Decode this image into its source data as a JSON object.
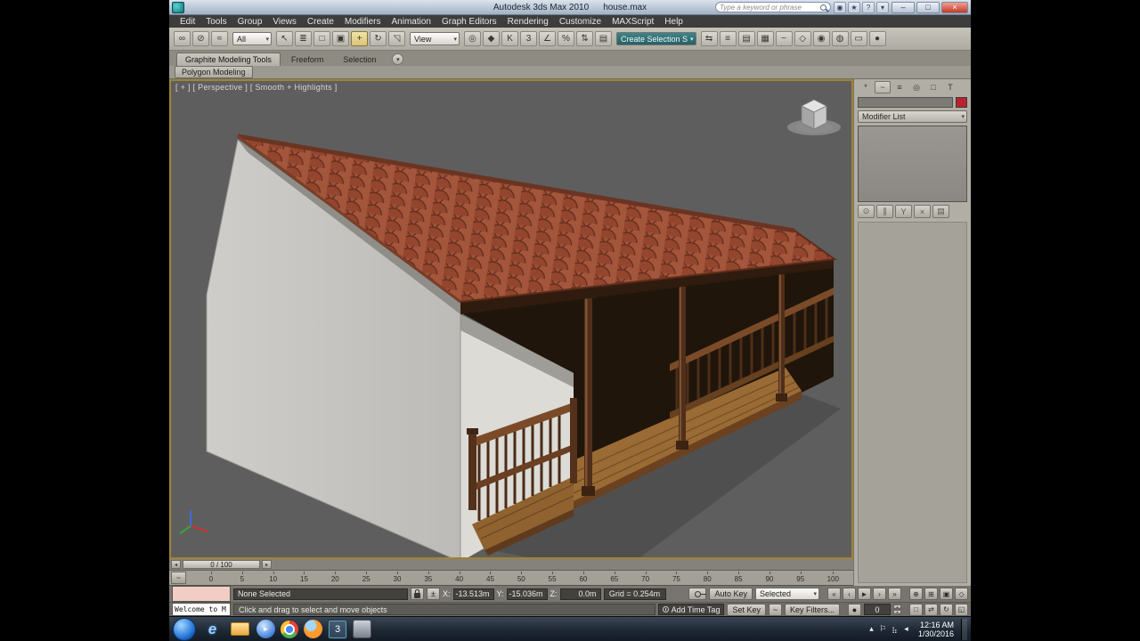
{
  "colors": {
    "brand_teal": "#1f9ca3",
    "object_color_swatch": "#b8232e",
    "viewport_border": "#a08433",
    "close_button_red": "#c23b28",
    "active_tool_highlight": "#e8d28a"
  },
  "titlebar": {
    "app_title": "Autodesk 3ds Max 2010",
    "file_name": "house.max",
    "search_placeholder": "Type a keyword or phrase",
    "infocenter_icons": [
      {
        "name": "communication-center-icon",
        "glyph": "◉"
      },
      {
        "name": "favorites-star-icon",
        "glyph": "★"
      },
      {
        "name": "help-icon",
        "glyph": "?"
      },
      {
        "name": "infocenter-menu-icon",
        "glyph": "▾"
      }
    ],
    "window_buttons": [
      {
        "name": "minimize-button",
        "glyph": "–"
      },
      {
        "name": "maximize-button",
        "glyph": "□"
      },
      {
        "name": "close-button",
        "glyph": "×",
        "cls": "close"
      }
    ]
  },
  "menubar": {
    "items": [
      "Edit",
      "Tools",
      "Group",
      "Views",
      "Create",
      "Modifiers",
      "Animation",
      "Graph Editors",
      "Rendering",
      "Customize",
      "MAXScript",
      "Help"
    ]
  },
  "toolbar": {
    "selection_filter_value": "All",
    "coordinate_system_value": "View",
    "named_sets_value": "Create Selection S",
    "segment1": [
      {
        "name": "select-and-link-icon",
        "glyph": "∞"
      },
      {
        "name": "unlink-selection-icon",
        "glyph": "⊘"
      },
      {
        "name": "bind-to-space-warp-icon",
        "glyph": "≈"
      }
    ],
    "segment2": [
      {
        "name": "select-object-icon",
        "glyph": "↖"
      },
      {
        "name": "select-by-name-icon",
        "glyph": "≣"
      },
      {
        "name": "rectangular-selection-region-icon",
        "glyph": "□"
      },
      {
        "name": "window-crossing-toggle-icon",
        "glyph": "▣"
      },
      {
        "name": "select-and-move-icon",
        "glyph": "+",
        "active": true
      },
      {
        "name": "select-and-rotate-icon",
        "glyph": "↻"
      },
      {
        "name": "select-and-scale-icon",
        "glyph": "◹"
      }
    ],
    "segment3": [
      {
        "name": "use-pivot-center-icon",
        "glyph": "◎"
      },
      {
        "name": "select-and-manipulate-icon",
        "glyph": "◆"
      },
      {
        "name": "keyboard-shortcut-override-icon",
        "glyph": "K"
      },
      {
        "name": "snaps-toggle-icon",
        "glyph": "3"
      },
      {
        "name": "angle-snap-icon",
        "glyph": "∠"
      },
      {
        "name": "percent-snap-icon",
        "glyph": "%"
      },
      {
        "name": "spinner-snap-icon",
        "glyph": "⇅"
      },
      {
        "name": "edit-named-selection-sets-icon",
        "glyph": "▤"
      }
    ],
    "segment4": [
      {
        "name": "mirror-icon",
        "glyph": "⇆"
      },
      {
        "name": "align-icon",
        "glyph": "≡"
      },
      {
        "name": "layer-manager-icon",
        "glyph": "▤"
      },
      {
        "name": "graphite-ribbon-toggle-icon",
        "glyph": "▦"
      },
      {
        "name": "curve-editor-icon",
        "glyph": "~"
      },
      {
        "name": "schematic-view-icon",
        "glyph": "◇"
      },
      {
        "name": "material-editor-icon",
        "glyph": "◉"
      },
      {
        "name": "render-setup-icon",
        "glyph": "◍"
      },
      {
        "name": "rendered-frame-window-icon",
        "glyph": "▭"
      },
      {
        "name": "render-production-icon",
        "glyph": "●"
      }
    ]
  },
  "ribbon": {
    "tab_graphite": "Graphite Modeling Tools",
    "tab_freeform": "Freeform",
    "tab_selection": "Selection",
    "subtab_polygon": "Polygon Modeling"
  },
  "viewport": {
    "label": "[ + ] [ Perspective ] [ Smooth + Highlights ]"
  },
  "command_panel": {
    "tabs": [
      {
        "name": "create-tab-icon",
        "glyph": "*"
      },
      {
        "name": "modify-tab-icon",
        "glyph": "~",
        "active": true
      },
      {
        "name": "hierarchy-tab-icon",
        "glyph": "≡"
      },
      {
        "name": "motion-tab-icon",
        "glyph": "◎"
      },
      {
        "name": "display-tab-icon",
        "glyph": "□"
      },
      {
        "name": "utilities-tab-icon",
        "glyph": "T"
      }
    ],
    "object_name_value": "",
    "modifier_list_label": "Modifier List",
    "stack_buttons": [
      {
        "name": "pin-stack-button",
        "glyph": "⊙"
      },
      {
        "name": "show-end-result-button",
        "glyph": "∥"
      },
      {
        "name": "make-unique-button",
        "glyph": "Y"
      },
      {
        "name": "remove-modifier-button",
        "glyph": "×"
      },
      {
        "name": "configure-modifier-sets-button",
        "glyph": "▤"
      }
    ]
  },
  "timeline": {
    "slider_label": "0 / 100",
    "ticks": [
      "0",
      "5",
      "10",
      "15",
      "20",
      "25",
      "30",
      "35",
      "40",
      "45",
      "50",
      "55",
      "60",
      "65",
      "70",
      "75",
      "80",
      "85",
      "90",
      "95",
      "100"
    ]
  },
  "status": {
    "listener_text": "Welcome to M",
    "selection": "None Selected",
    "x_label": "X:",
    "x_value": "-13.513m",
    "y_label": "Y:",
    "y_value": "-15.036m",
    "z_label": "Z:",
    "z_value": "0.0m",
    "grid": "Grid = 0.254m",
    "prompt": "Click and drag to select and move objects",
    "add_time_tag": "Add Time Tag",
    "auto_key": "Auto Key",
    "set_key": "Set Key",
    "key_mode_value": "Selected",
    "key_filters": "Key Filters...",
    "frame_value": "0"
  },
  "transport": {
    "row1": [
      {
        "name": "go-to-start-button",
        "glyph": "«"
      },
      {
        "name": "previous-frame-button",
        "glyph": "‹"
      },
      {
        "name": "play-animation-button",
        "glyph": "►"
      },
      {
        "name": "next-frame-button",
        "glyph": "›"
      },
      {
        "name": "go-to-end-button",
        "glyph": "»"
      }
    ],
    "nav1": [
      {
        "name": "zoom-button",
        "glyph": "⊕"
      },
      {
        "name": "zoom-all-button",
        "glyph": "⊞"
      },
      {
        "name": "zoom-extents-button",
        "glyph": "▣"
      },
      {
        "name": "field-of-view-button",
        "glyph": "◇"
      }
    ],
    "nav2": [
      {
        "name": "zoom-region-button",
        "glyph": "□"
      },
      {
        "name": "pan-view-button",
        "glyph": "⇄"
      },
      {
        "name": "orbit-viewport-button",
        "glyph": "↻"
      },
      {
        "name": "maximize-viewport-toggle-button",
        "glyph": "◱"
      }
    ]
  },
  "taskbar": {
    "items": [
      {
        "name": "start-button",
        "cls": "ti-start"
      },
      {
        "name": "internet-explorer-icon",
        "cls": "ti-ie",
        "glyph": "e"
      },
      {
        "name": "file-explorer-icon",
        "cls": "ti-folder"
      },
      {
        "name": "media-player-icon",
        "cls": "ti-media",
        "glyph": "►"
      },
      {
        "name": "chrome-icon",
        "cls": "ti-chrome"
      },
      {
        "name": "firefox-icon",
        "cls": "ti-firefox"
      },
      {
        "name": "3dsmax-taskbar-icon",
        "cls": "ti-max",
        "glyph": "3",
        "active": true
      },
      {
        "name": "secondary-app-icon",
        "cls": "ti-app2"
      }
    ],
    "tray_icons": [
      {
        "name": "show-hidden-icons-button",
        "glyph": "▴"
      },
      {
        "name": "action-center-icon",
        "glyph": "⚐"
      },
      {
        "name": "network-status-icon",
        "glyph": "⣦"
      },
      {
        "name": "volume-icon",
        "glyph": "◂"
      }
    ],
    "time": "12:16 AM",
    "date": "1/30/2016"
  }
}
